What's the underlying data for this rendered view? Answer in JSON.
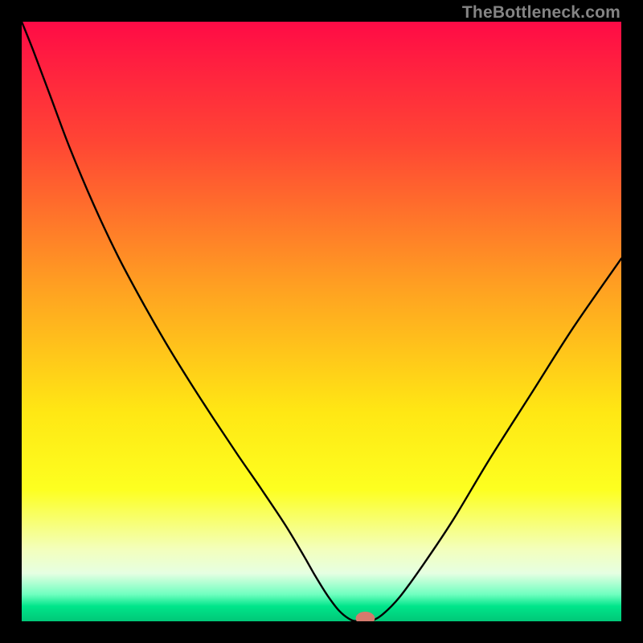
{
  "credit": "TheBottleneck.com",
  "chart_data": {
    "type": "line",
    "title": "",
    "xlabel": "",
    "ylabel": "",
    "xlim": [
      0,
      100
    ],
    "ylim": [
      0,
      100
    ],
    "background_gradient": {
      "stops": [
        {
          "offset": 0.0,
          "color": "#ff0b46"
        },
        {
          "offset": 0.2,
          "color": "#ff4534"
        },
        {
          "offset": 0.45,
          "color": "#ffa321"
        },
        {
          "offset": 0.65,
          "color": "#ffe714"
        },
        {
          "offset": 0.78,
          "color": "#fdff20"
        },
        {
          "offset": 0.88,
          "color": "#f3ffbc"
        },
        {
          "offset": 0.92,
          "color": "#e6ffe2"
        },
        {
          "offset": 0.955,
          "color": "#70ffc0"
        },
        {
          "offset": 0.975,
          "color": "#00e58a"
        },
        {
          "offset": 1.0,
          "color": "#00c878"
        }
      ]
    },
    "series": [
      {
        "name": "bottleneck-curve",
        "color": "#000000",
        "width": 2.4,
        "x": [
          0.0,
          2,
          5,
          8,
          12,
          16,
          20,
          24,
          28,
          32,
          36,
          40,
          44,
          47,
          49,
          51,
          53,
          55,
          56.5,
          58,
          60,
          63,
          67,
          72,
          78,
          85,
          92,
          100
        ],
        "y": [
          100,
          95,
          87,
          79,
          69.5,
          61,
          53.5,
          46.5,
          40,
          33.8,
          27.8,
          22,
          16,
          11,
          7.5,
          4.3,
          1.7,
          0.2,
          0,
          0,
          1.0,
          4.0,
          9.5,
          17,
          27,
          38,
          49,
          60.5
        ]
      }
    ],
    "marker": {
      "name": "current-point",
      "x": 57.3,
      "y": 0.5,
      "rx": 1.6,
      "ry": 1.1,
      "color": "#d57a6d"
    }
  }
}
